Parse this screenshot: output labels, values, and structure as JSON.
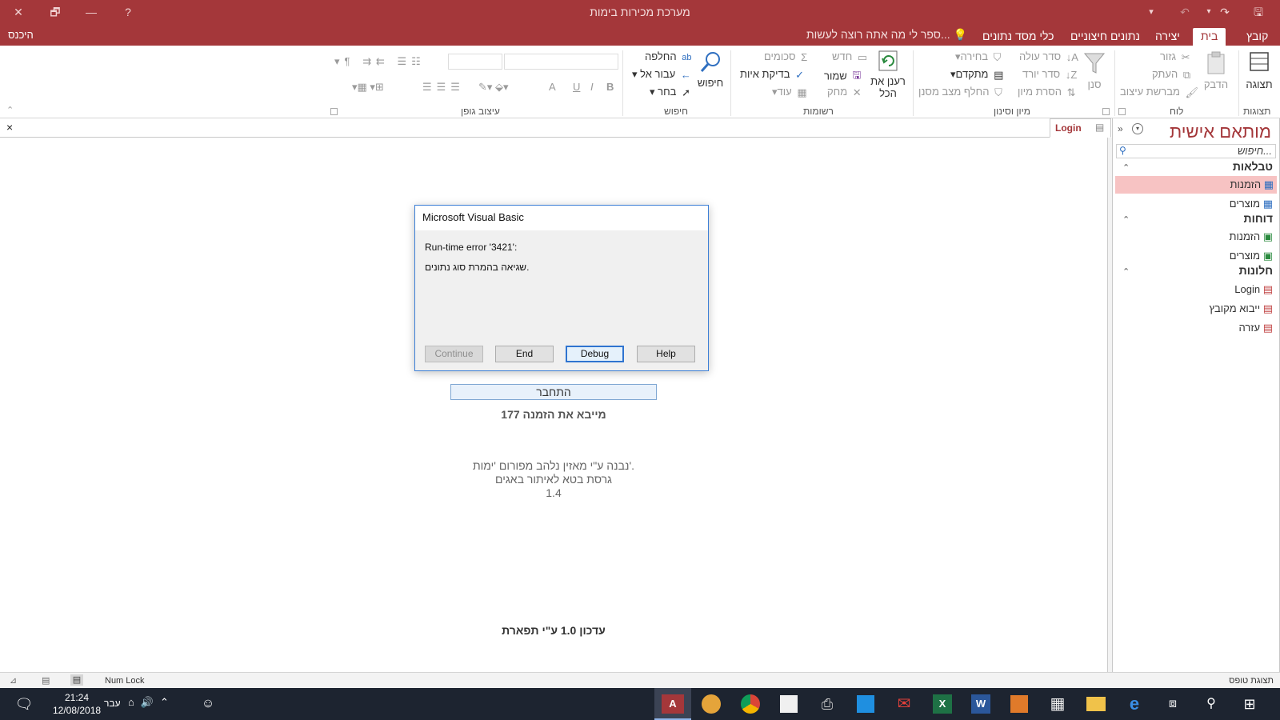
{
  "window": {
    "title": "מערכת מכירות בימות",
    "help": "?"
  },
  "ribbon_tabs": {
    "file": "קובץ",
    "home": "בית",
    "create": "יצירה",
    "external": "נתונים חיצוניים",
    "dbtools": "כלי מסד נתונים",
    "tellme": "ספר לי מה אתה רוצה לעשות...",
    "signin": "היכנס"
  },
  "ribbon": {
    "views": {
      "label": "תצוגות",
      "view": "תצוגה"
    },
    "clipboard": {
      "label": "לוח",
      "paste": "הדבק",
      "cut": "גזור",
      "copy": "העתק",
      "painter": "מברשת עיצוב"
    },
    "sort": {
      "label": "מיון וסינון",
      "filter": "סנן",
      "ascending": "סדר עולה",
      "descending": "סדר יורד",
      "remove": "הסרת מיון",
      "selection": "בחירה",
      "advanced": "מתקדם",
      "toggle": "החלף מצב מסנן"
    },
    "records": {
      "label": "רשומות",
      "refresh": "רענן את הכל",
      "new": "חדש",
      "save": "שמור",
      "delete": "מחק",
      "totals": "סכומים",
      "spelling": "בדיקת איות",
      "more": "עוד"
    },
    "find": {
      "label": "חיפוש",
      "find": "חיפוש",
      "replace": "החלפה",
      "goto": "עבור אל",
      "select": "בחר"
    },
    "text": {
      "label": "עיצוב גופן",
      "bold": "B",
      "italic": "I",
      "underline": "U",
      "fontcolor": "A"
    }
  },
  "nav": {
    "title": "מותאם אישית",
    "search_placeholder": "חיפוש...",
    "groups": {
      "tables": "טבלאות",
      "reports": "דוחות",
      "forms": "חלונות"
    },
    "tables": [
      "הזמנות",
      "מוצרים"
    ],
    "reports": [
      "הזמנות",
      "מוצרים"
    ],
    "forms": [
      "Login",
      "ייבוא מקובץ",
      "עזרה"
    ]
  },
  "doc_tab": {
    "label": "Login",
    "close": "×"
  },
  "form": {
    "connect": "התחבר",
    "importing": "מייבא את הזמנה 177",
    "credit1": "נבנה ע\"י מאזין נלהב מפורום 'ימות'.",
    "credit2": "גרסת בטא לאיתור באגים",
    "version": "1.4",
    "update": "עדכון 1.0 ע\"י תפארת"
  },
  "dialog": {
    "title": "Microsoft Visual Basic",
    "error": "Run-time error '3421':",
    "message": "שגיאה בהמרת סוג נתונים.",
    "buttons": {
      "continue": "Continue",
      "end": "End",
      "debug": "Debug",
      "help": "Help"
    }
  },
  "status": {
    "left": "תצוגת טופס",
    "numlock": "Num Lock"
  },
  "taskbar": {
    "time": "21:24",
    "date": "12/08/2018",
    "lang": "עבר"
  },
  "colors": {
    "accent": "#a4373a",
    "taskbar": "#1d2430",
    "selection": "#f7c3c3"
  }
}
